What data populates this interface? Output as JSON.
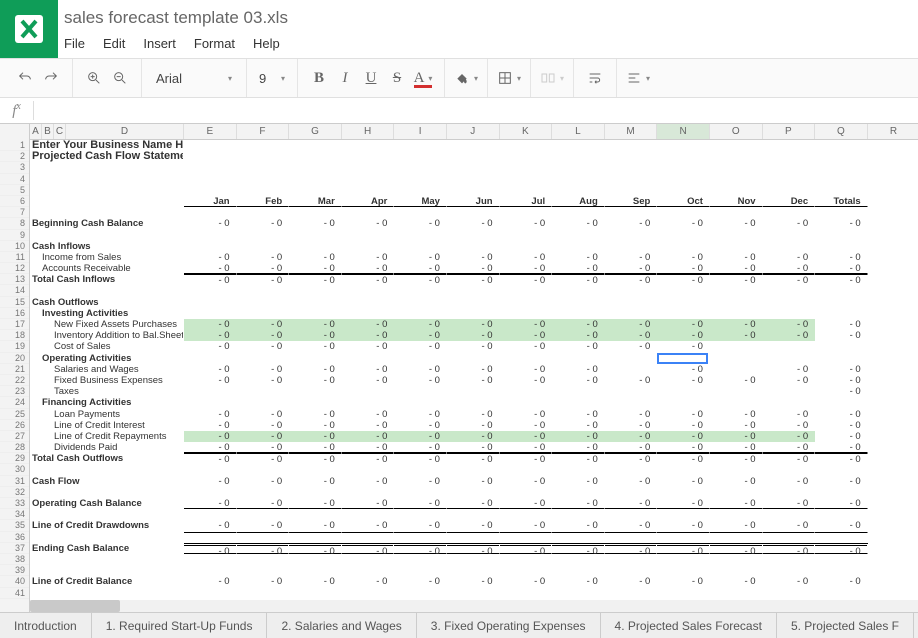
{
  "doc_title": "sales forecast template 03.xls",
  "menus": [
    "File",
    "Edit",
    "Insert",
    "Format",
    "Help"
  ],
  "toolbar": {
    "font_name": "Arial",
    "font_size": "9"
  },
  "columns_small": [
    "A",
    "B",
    "C"
  ],
  "column_D": "D",
  "month_cols": [
    "E",
    "F",
    "G",
    "H",
    "I",
    "J",
    "K",
    "L",
    "M",
    "N",
    "O",
    "P",
    "Q",
    "R"
  ],
  "selected_col_idx": 9,
  "months": [
    "Jan",
    "Feb",
    "Mar",
    "Apr",
    "May",
    "Jun",
    "Jul",
    "Aug",
    "Sep",
    "Oct",
    "Nov",
    "Dec",
    "Totals"
  ],
  "title1": "Enter Your Business Name Here",
  "title2": "Projected Cash Flow Statement - Year One",
  "rows": [
    {
      "r": 1,
      "type": "title1"
    },
    {
      "r": 2,
      "type": "title2"
    },
    {
      "r": 3,
      "type": "blank"
    },
    {
      "r": 4,
      "type": "blank"
    },
    {
      "r": 5,
      "type": "blank"
    },
    {
      "r": 6,
      "type": "months_header"
    },
    {
      "r": 7,
      "type": "blank"
    },
    {
      "r": 8,
      "label": "Beginning Cash Balance",
      "bold": true,
      "vals": "all0"
    },
    {
      "r": 9,
      "type": "blank"
    },
    {
      "r": 10,
      "label": "Cash Inflows",
      "bold": true
    },
    {
      "r": 11,
      "label": "Income from Sales",
      "indent": 1,
      "vals": "all0"
    },
    {
      "r": 12,
      "label": "Accounts Receivable",
      "indent": 1,
      "vals": "all0",
      "underlineTotals": true
    },
    {
      "r": 13,
      "label": "Total Cash Inflows",
      "bold": true,
      "vals": "all0",
      "topBorder": true
    },
    {
      "r": 14,
      "type": "blank"
    },
    {
      "r": 15,
      "label": "Cash Outflows",
      "bold": true
    },
    {
      "r": 16,
      "label": "Investing Activities",
      "bold": true,
      "indent": 1
    },
    {
      "r": 17,
      "label": "New Fixed Assets Purchases",
      "indent": 2,
      "vals": "all0",
      "green": true
    },
    {
      "r": 18,
      "label": "Inventory Addition to Bal.Sheet",
      "indent": 2,
      "vals": "all0",
      "green": true
    },
    {
      "r": 19,
      "label": "Cost of Sales",
      "indent": 2,
      "vals": "all0_to_oct"
    },
    {
      "r": 20,
      "label": "Operating Activities",
      "bold": true,
      "indent": 1,
      "activeN": true
    },
    {
      "r": 21,
      "label": "Salaries and Wages",
      "indent": 2,
      "vals": "skip_sep_nov"
    },
    {
      "r": 22,
      "label": "Fixed Business Expenses",
      "indent": 2,
      "vals": "all0"
    },
    {
      "r": 23,
      "label": "Taxes",
      "indent": 2,
      "vals": "totals_only"
    },
    {
      "r": 24,
      "label": "Financing Activities",
      "bold": true,
      "indent": 1
    },
    {
      "r": 25,
      "label": "Loan Payments",
      "indent": 2,
      "vals": "all0"
    },
    {
      "r": 26,
      "label": "Line of Credit Interest",
      "indent": 2,
      "vals": "all0"
    },
    {
      "r": 27,
      "label": "Line of Credit Repayments",
      "indent": 2,
      "vals": "all0",
      "green": true
    },
    {
      "r": 28,
      "label": "Dividends Paid",
      "indent": 2,
      "vals": "all0",
      "underlineTotals": true
    },
    {
      "r": 29,
      "label": "Total Cash Outflows",
      "bold": true,
      "vals": "all0",
      "topBorder": true
    },
    {
      "r": 30,
      "type": "blank"
    },
    {
      "r": 31,
      "label": "Cash Flow",
      "bold": true,
      "vals": "all0"
    },
    {
      "r": 32,
      "type": "blank"
    },
    {
      "r": 33,
      "label": "Operating Cash Balance",
      "bold": true,
      "vals": "all0",
      "underlineNums": true
    },
    {
      "r": 34,
      "type": "blank"
    },
    {
      "r": 35,
      "label": "Line of Credit Drawdowns",
      "bold": true,
      "vals": "all0"
    },
    {
      "r": 36,
      "type": "blank",
      "topBorderNums": true
    },
    {
      "r": 37,
      "label": "Ending Cash Balance",
      "bold": true,
      "vals": "all0",
      "dblTop": true,
      "underlineNums": true
    },
    {
      "r": 38,
      "type": "blank"
    },
    {
      "r": 39,
      "type": "blank"
    },
    {
      "r": 40,
      "label": "Line of Credit Balance",
      "bold": true,
      "vals": "all0"
    },
    {
      "r": 41,
      "type": "blank"
    }
  ],
  "zero_display": "- 0",
  "sheet_tabs": [
    "Introduction",
    "1. Required Start-Up Funds",
    "2. Salaries and Wages",
    "3. Fixed Operating Expenses",
    "4. Projected Sales Forecast",
    "5. Projected Sales F"
  ],
  "active_cell": {
    "col": "N",
    "row": 20
  }
}
